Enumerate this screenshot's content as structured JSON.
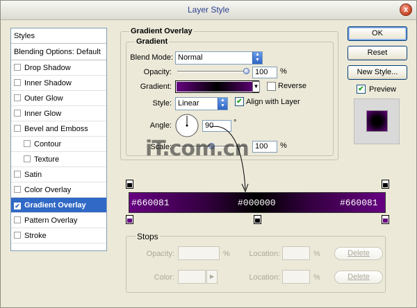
{
  "window": {
    "title": "Layer Style",
    "close": "x"
  },
  "styles_list": {
    "header": "Styles",
    "blending": "Blending Options: Default",
    "items": [
      {
        "label": "Drop Shadow",
        "checked": false,
        "sub": false
      },
      {
        "label": "Inner Shadow",
        "checked": false,
        "sub": false
      },
      {
        "label": "Outer Glow",
        "checked": false,
        "sub": false
      },
      {
        "label": "Inner Glow",
        "checked": false,
        "sub": false
      },
      {
        "label": "Bevel and Emboss",
        "checked": false,
        "sub": false
      },
      {
        "label": "Contour",
        "checked": false,
        "sub": true
      },
      {
        "label": "Texture",
        "checked": false,
        "sub": true
      },
      {
        "label": "Satin",
        "checked": false,
        "sub": false
      },
      {
        "label": "Color Overlay",
        "checked": false,
        "sub": false
      },
      {
        "label": "Gradient Overlay",
        "checked": true,
        "sub": false,
        "selected": true
      },
      {
        "label": "Pattern Overlay",
        "checked": false,
        "sub": false
      },
      {
        "label": "Stroke",
        "checked": false,
        "sub": false
      }
    ]
  },
  "gradient_overlay": {
    "title": "Gradient Overlay",
    "subtitle": "Gradient",
    "blend_mode_label": "Blend Mode:",
    "blend_mode_value": "Normal",
    "opacity_label": "Opacity:",
    "opacity_value": "100",
    "opacity_level": 1.0,
    "percent": "%",
    "gradient_label": "Gradient:",
    "reverse_label": "Reverse",
    "reverse_checked": false,
    "style_label": "Style:",
    "style_value": "Linear",
    "align_label": "Align with Layer",
    "align_checked": true,
    "angle_label": "Angle:",
    "angle_value": "90",
    "degree": "°",
    "scale_label": "Scale:",
    "scale_value": "100",
    "scale_level": 0.5
  },
  "buttons": {
    "ok": "OK",
    "reset": "Reset",
    "new_style": "New Style...",
    "preview": "Preview",
    "preview_checked": true
  },
  "gradient_editor": {
    "left_stop": "#660081",
    "mid_stop": "#000000",
    "right_stop": "#660081",
    "colors": {
      "edge": "#660081",
      "mid": "#000000"
    }
  },
  "watermark": "iT.com.cn",
  "stops": {
    "title": "Stops",
    "opacity_label": "Opacity:",
    "color_label": "Color:",
    "location_label": "Location:",
    "percent": "%",
    "delete_label": "Delete"
  }
}
